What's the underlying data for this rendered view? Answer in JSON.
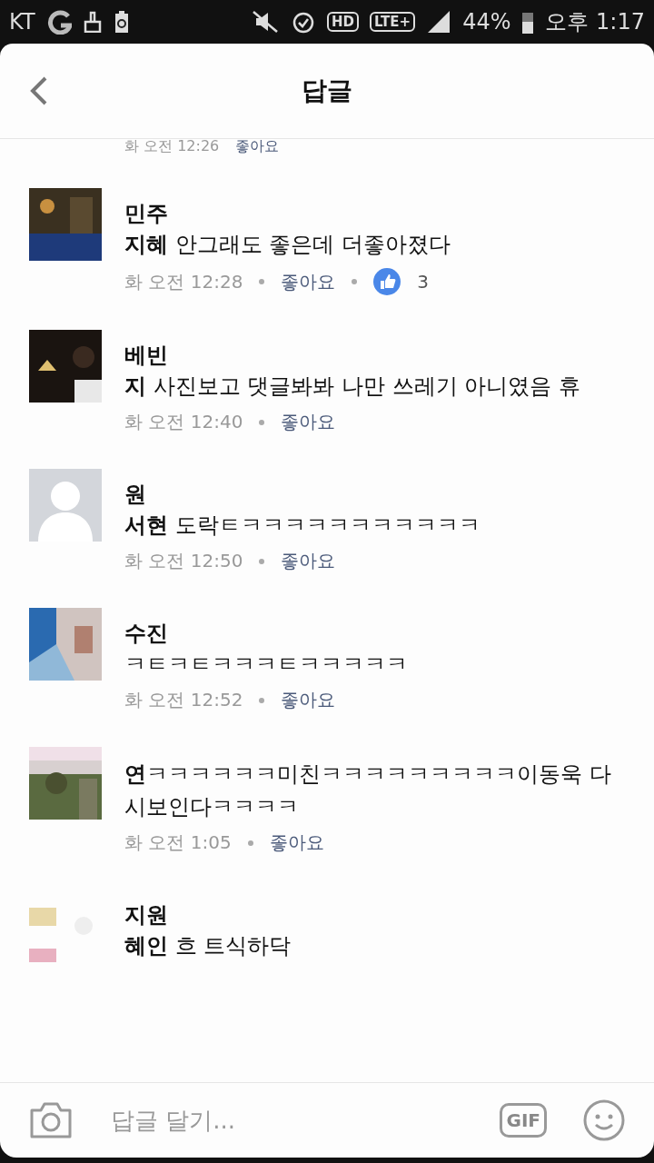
{
  "status_bar": {
    "carrier": "KT",
    "hd": "HD",
    "network": "LTE+",
    "battery": "44%",
    "time": "오후 1:17"
  },
  "header": {
    "title": "답글"
  },
  "partial_meta": {
    "time": "화 오전 12:26",
    "like": "좋아요"
  },
  "comments": [
    {
      "name": "민주",
      "text": "**지혜** 안그래도 좋은데 더좋아졌다",
      "time": "화 오전 12:28",
      "like": "좋아요",
      "reactions": "3"
    },
    {
      "name": "베빈",
      "text": "**지** 사진보고 댓글봐봐 나만 쓰레기 아니였음 휴",
      "time": "화 오전 12:40",
      "like": "좋아요"
    },
    {
      "avatar": {
        "kind": "default"
      },
      "name": "원",
      "text": "**서현** 도락ㅌㅋㅋㅋㅋㅋㅋㅋㅋㅋㅋㅋ",
      "time": "화 오전 12:50",
      "like": "좋아요"
    },
    {
      "name": "수진",
      "text": "ㅋㅌㅋㅌㅋㅋㅋㅌㅋㅋㅋㅋㅋ",
      "time": "화 오전 12:52",
      "like": "좋아요"
    },
    {
      "text": "**연**ㅋㅋㅋㅋㅋㅋ미친ㅋㅋㅋㅋㅋㅋㅋㅋㅋ이동욱 다시보인다ㅋㅋㅋㅋ",
      "time": "화 오전 1:05",
      "like": "좋아요"
    },
    {
      "name": "지원",
      "text": "**혜인** 흐 트식하닥"
    }
  ],
  "composer": {
    "placeholder": "답글 달기...",
    "gif": "GIF"
  }
}
